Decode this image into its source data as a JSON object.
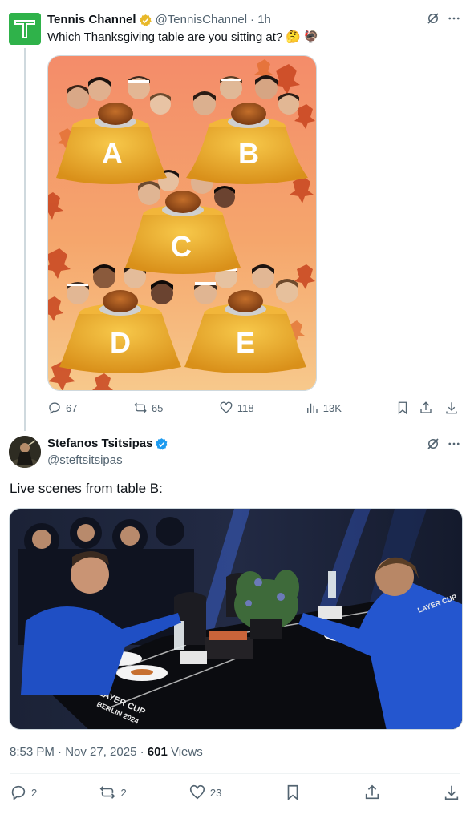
{
  "parent_tweet": {
    "author_name": "Tennis Channel",
    "handle": "@TennisChannel",
    "time": "· 1h",
    "text": "Which Thanksgiving table are you sitting at?",
    "emojis": [
      "🤔",
      "🦃"
    ],
    "image": {
      "tables": [
        "A",
        "B",
        "C",
        "D",
        "E"
      ]
    },
    "stats": {
      "replies": "67",
      "reposts": "65",
      "likes": "118",
      "views": "13K"
    },
    "icons": {
      "grok": "grok-icon",
      "more": "more-icon",
      "reply": "reply-icon",
      "repost": "repost-icon",
      "like": "like-icon",
      "views": "views-icon",
      "bookmark": "bookmark-icon",
      "share": "share-icon",
      "download": "download-icon"
    }
  },
  "main_tweet": {
    "author_name": "Stefanos Tsitsipas",
    "handle": "@steftsitsipas",
    "text": "Live scenes from table B:",
    "photo": {
      "table_print": "LAYER CUP",
      "table_print_city": "BERLIN 2024",
      "jacket_print": "LAYER CUP"
    },
    "timestamp": "8:53 PM · Nov 27, 2025 · ",
    "views_count": "601",
    "views_label": " Views",
    "stats": {
      "replies": "2",
      "reposts": "2",
      "likes": "23"
    }
  },
  "colors": {
    "text_primary": "#0f1419",
    "text_secondary": "#536471",
    "verified_gold": "#e8b829",
    "verified_blue": "#1d9bf0",
    "tc_green": "#2fb24a",
    "tablecloth": "#e9a320",
    "card_bg": "#f4a06a"
  }
}
